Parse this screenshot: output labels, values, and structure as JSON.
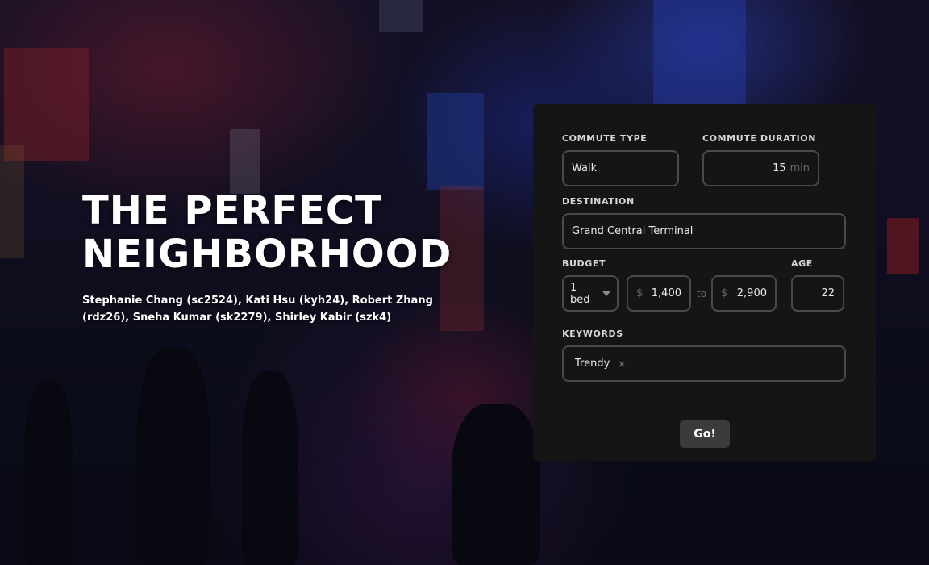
{
  "hero": {
    "title_line1": "THE PERFECT",
    "title_line2": "NEIGHBORHOOD",
    "authors": "Stephanie Chang (sc2524), Kati Hsu (kyh24), Robert Zhang (rdz26), Sneha Kumar (sk2279), Shirley Kabir (szk4)"
  },
  "form": {
    "commute_type": {
      "label": "COMMUTE TYPE",
      "value": "Walk"
    },
    "commute_duration": {
      "label": "COMMUTE DURATION",
      "value": "15",
      "unit": "min"
    },
    "destination": {
      "label": "DESTINATION",
      "value": "Grand Central Terminal"
    },
    "budget": {
      "label": "BUDGET",
      "bedrooms": "1 bed",
      "currency": "$",
      "min": "1,400",
      "separator": "to",
      "max": "2,900"
    },
    "age": {
      "label": "AGE",
      "value": "22"
    },
    "keywords": {
      "label": "KEYWORDS",
      "tags": [
        {
          "label": "Trendy",
          "remove": "×"
        }
      ]
    },
    "submit_label": "Go!"
  },
  "colors": {
    "panel": "#151515",
    "field_border": "#4a4a4a",
    "button": "#3b3b3b",
    "text": "#ffffff"
  }
}
